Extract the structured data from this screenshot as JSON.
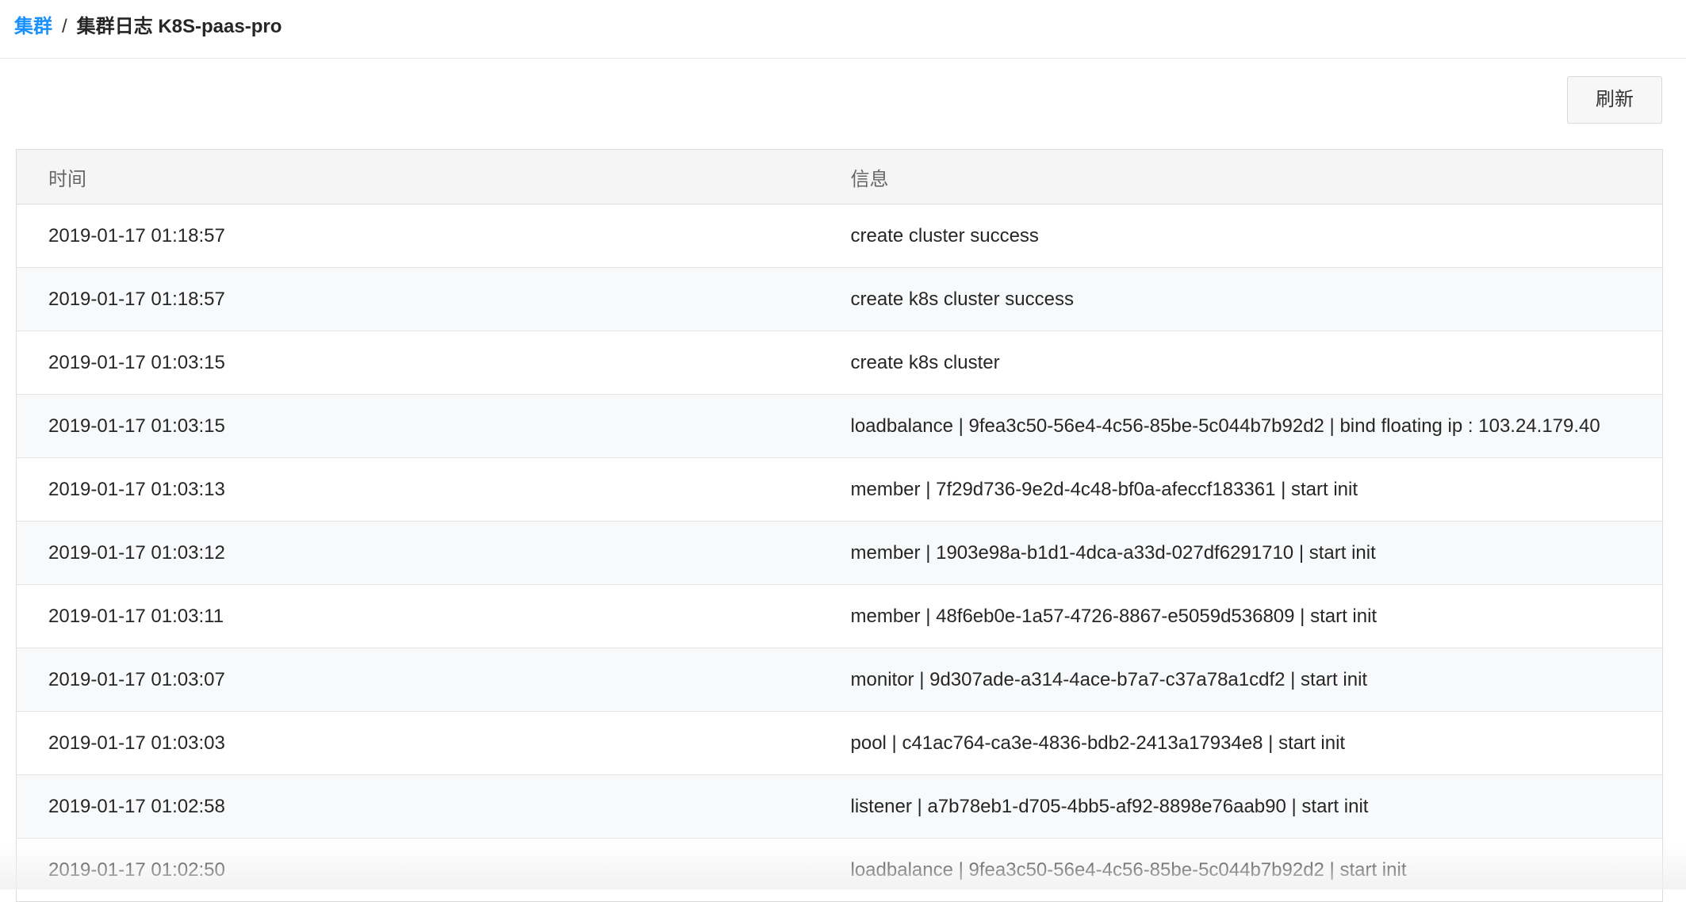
{
  "breadcrumb": {
    "parent": "集群",
    "separator": "/",
    "current": "集群日志 K8S-paas-pro"
  },
  "toolbar": {
    "refresh_label": "刷新"
  },
  "table": {
    "columns": [
      "时间",
      "信息"
    ],
    "rows": [
      {
        "time": "2019-01-17 01:18:57",
        "message": "create cluster success"
      },
      {
        "time": "2019-01-17 01:18:57",
        "message": "create k8s cluster success"
      },
      {
        "time": "2019-01-17 01:03:15",
        "message": "create k8s cluster"
      },
      {
        "time": "2019-01-17 01:03:15",
        "message": "loadbalance | 9fea3c50-56e4-4c56-85be-5c044b7b92d2 | bind floating ip : 103.24.179.40"
      },
      {
        "time": "2019-01-17 01:03:13",
        "message": "member | 7f29d736-9e2d-4c48-bf0a-afeccf183361 | start init"
      },
      {
        "time": "2019-01-17 01:03:12",
        "message": "member | 1903e98a-b1d1-4dca-a33d-027df6291710 | start init"
      },
      {
        "time": "2019-01-17 01:03:11",
        "message": "member | 48f6eb0e-1a57-4726-8867-e5059d536809 | start init"
      },
      {
        "time": "2019-01-17 01:03:07",
        "message": "monitor | 9d307ade-a314-4ace-b7a7-c37a78a1cdf2 | start init"
      },
      {
        "time": "2019-01-17 01:03:03",
        "message": "pool | c41ac764-ca3e-4836-bdb2-2413a17934e8 | start init"
      },
      {
        "time": "2019-01-17 01:02:58",
        "message": "listener | a7b78eb1-d705-4bb5-af92-8898e76aab90 | start init"
      },
      {
        "time": "2019-01-17 01:02:50",
        "message": "loadbalance | 9fea3c50-56e4-4c56-85be-5c044b7b92d2 | start init"
      }
    ]
  },
  "colors": {
    "link": "#1890ff",
    "header_bg": "#f5f5f5",
    "stripe_bg": "#f7f9fb"
  }
}
